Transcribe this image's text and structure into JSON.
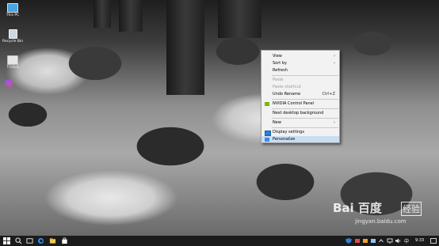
{
  "desktop": {
    "icons": [
      {
        "label": "This PC",
        "icon": "computer-icon"
      },
      {
        "label": "Recycle Bin",
        "icon": "recycle-bin-icon"
      },
      {
        "label": "TOOLS",
        "icon": "folder-icon"
      }
    ]
  },
  "context_menu": {
    "items": [
      {
        "label": "View",
        "submenu": true
      },
      {
        "label": "Sort by",
        "submenu": true
      },
      {
        "label": "Refresh"
      },
      {
        "label": "Paste",
        "disabled": true
      },
      {
        "label": "Paste shortcut",
        "disabled": true
      },
      {
        "label": "Undo Rename",
        "shortcut": "Ctrl+Z"
      },
      {
        "label": "NVIDIA Control Panel",
        "icon": "nvidia-icon"
      },
      {
        "label": "Next desktop background"
      },
      {
        "label": "New",
        "submenu": true
      },
      {
        "label": "Display settings",
        "icon": "display-icon"
      },
      {
        "label": "Personalize",
        "icon": "personalize-icon",
        "highlighted": true
      }
    ],
    "submenu_arrow": "›"
  },
  "taskbar": {
    "clock": "9:33",
    "colors": {
      "background": "#1b1b1b",
      "start_icon": "#ffffff",
      "accent": "#0078d7"
    }
  },
  "watermark": {
    "logo_text": "Bai 百度",
    "sub_text": "jingyan.baidu.com",
    "badge": "经验"
  }
}
